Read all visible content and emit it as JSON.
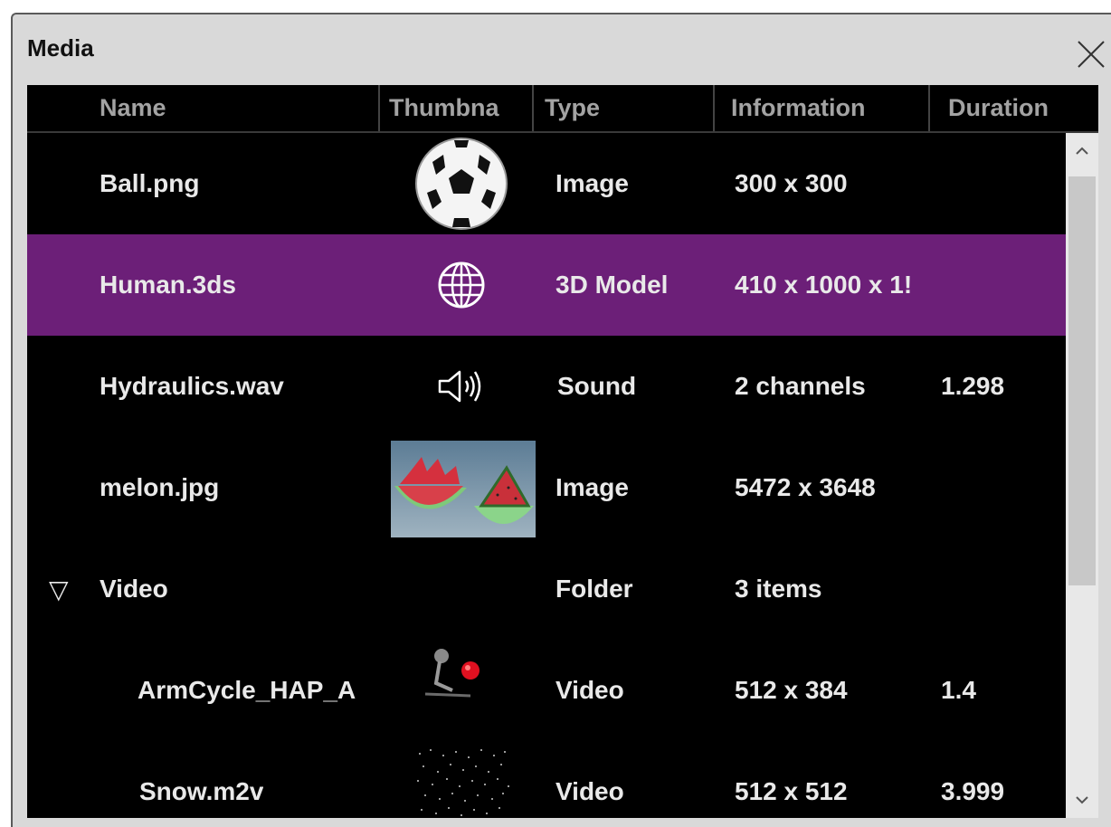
{
  "window": {
    "title": "Media"
  },
  "columns": [
    "Name",
    "Thumbna",
    "Type",
    "Information",
    "Duration"
  ],
  "rows": [
    {
      "name": "Ball.png",
      "thumbnail": "soccer-ball-icon",
      "type": "Image",
      "information": "300 x 300",
      "duration": "",
      "selected": false,
      "indent": 0
    },
    {
      "name": "Human.3ds",
      "thumbnail": "globe-icon",
      "type": "3D Model",
      "information": "410 x 1000 x 1!",
      "duration": "",
      "selected": true,
      "indent": 0
    },
    {
      "name": "Hydraulics.wav",
      "thumbnail": "speaker-icon",
      "type": "Sound",
      "information": "2 channels",
      "duration": "1.298",
      "selected": false,
      "indent": 0
    },
    {
      "name": "melon.jpg",
      "thumbnail": "watermelon-photo",
      "type": "Image",
      "information": "5472 x 3648",
      "duration": "",
      "selected": false,
      "indent": 0
    },
    {
      "name": "Video",
      "thumbnail": "",
      "type": "Folder",
      "information": "3 items",
      "duration": "",
      "selected": false,
      "indent": 0,
      "expanded": true,
      "toggle": "▽"
    },
    {
      "name": "ArmCycle_HAP_A",
      "thumbnail": "robot-arm-video-thumb",
      "type": "Video",
      "information": "512 x 384",
      "duration": "1.4",
      "selected": false,
      "indent": 1
    },
    {
      "name": "Snow.m2v",
      "thumbnail": "snow-video-thumb",
      "type": "Video",
      "information": "512 x 512",
      "duration": "3.999",
      "selected": false,
      "indent": 1
    }
  ],
  "scrollbar": {
    "up": "^",
    "down": "v"
  },
  "colors": {
    "selected": "#6c1f78",
    "background": "#000000",
    "text": "#e9e9e9",
    "header_text": "#a3a3a3"
  }
}
